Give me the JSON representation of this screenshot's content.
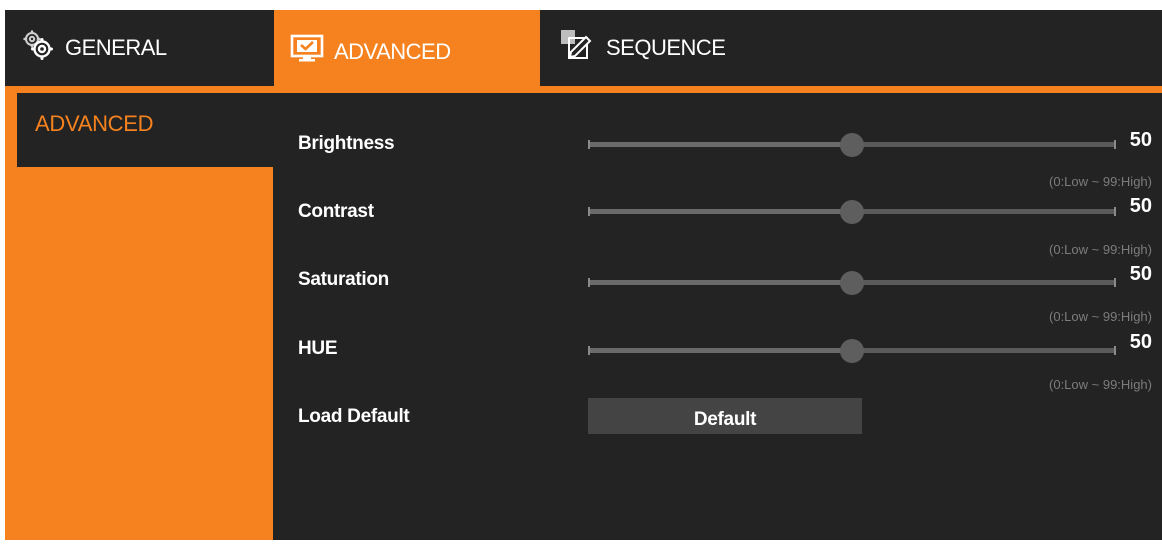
{
  "tabs": {
    "general": {
      "label": "GENERAL",
      "icon": "gears-icon"
    },
    "advanced": {
      "label": "ADVANCED",
      "icon": "monitor-check-icon"
    },
    "sequence": {
      "label": "SEQUENCE",
      "icon": "sequence-edit-icon"
    }
  },
  "sidebar": {
    "active_item": "ADVANCED"
  },
  "settings": [
    {
      "key": "brightness",
      "label": "Brightness",
      "value": "50",
      "fraction": 0.5,
      "hint": "(0:Low ~ 99:High)"
    },
    {
      "key": "contrast",
      "label": "Contrast",
      "value": "50",
      "fraction": 0.5,
      "hint": "(0:Low ~ 99:High)"
    },
    {
      "key": "saturation",
      "label": "Saturation",
      "value": "50",
      "fraction": 0.5,
      "hint": "(0:Low ~ 99:High)"
    },
    {
      "key": "hue",
      "label": "HUE",
      "value": "50",
      "fraction": 0.5,
      "hint": "(0:Low ~ 99:High)"
    }
  ],
  "load_default": {
    "label": "Load Default",
    "button_label": "Default"
  },
  "colors": {
    "accent": "#f5821f",
    "background": "#232323",
    "slider_thumb": "#5e5e5e",
    "button": "#444444"
  }
}
